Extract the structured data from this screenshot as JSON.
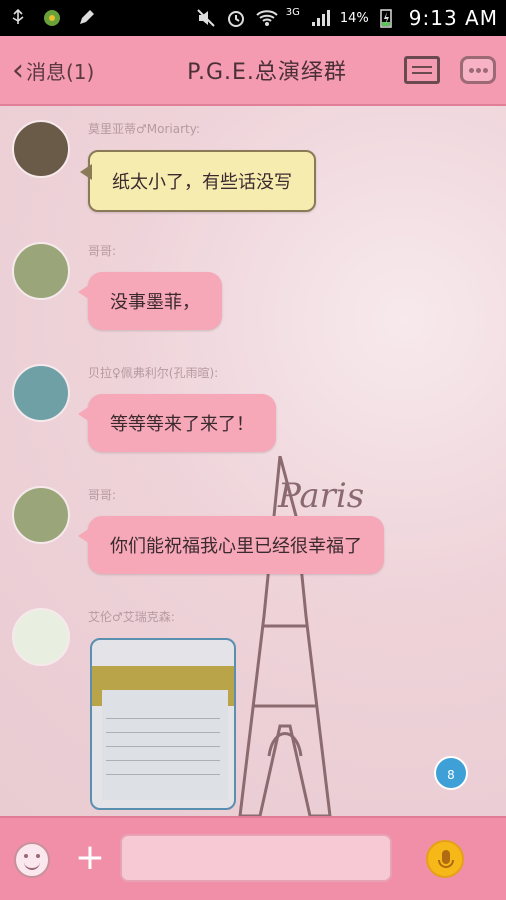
{
  "status_bar": {
    "battery": "14%",
    "network": "3G",
    "time": "9:13 AM"
  },
  "header": {
    "back_label": "消息(1)",
    "title": "P.G.E.总演绎群"
  },
  "background_text": "Paris",
  "messages": [
    {
      "sender": "莫里亚蒂♂Moriarty:",
      "text": "纸太小了，有些话没写"
    },
    {
      "sender": "哥哥:",
      "text": "没事墨菲，"
    },
    {
      "sender": "贝拉♀佩弗利尔(孔雨暄):",
      "text": "等等等来了来了！"
    },
    {
      "sender": "哥哥:",
      "text": "你们能祝福我心里已经很幸福了"
    },
    {
      "sender": "艾伦♂艾瑞克森:",
      "text": ""
    }
  ],
  "unread_badge": "8",
  "input": {
    "value": "",
    "placeholder": ""
  },
  "colors": {
    "header_pink": "#f49ab1",
    "bubble_pink": "#f6a7b8",
    "note_yellow": "#f7ecb0",
    "unread_blue": "#3fa0d8",
    "mic_yellow": "#f5b818"
  },
  "icons": {
    "back": "chevron-left-icon",
    "list": "list-icon",
    "more": "more-icon",
    "emoji": "smiley-icon",
    "plus": "plus-icon",
    "mic": "microphone-icon"
  }
}
